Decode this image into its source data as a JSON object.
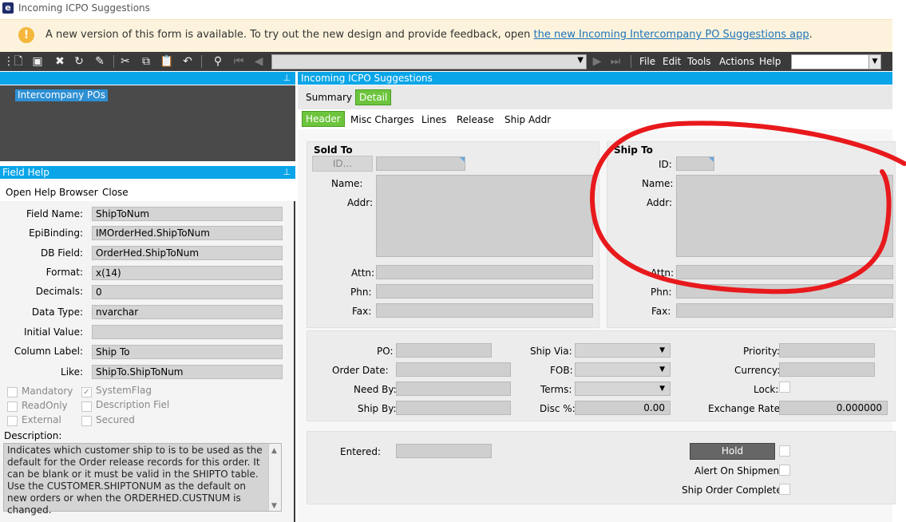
{
  "window": {
    "title": "Incoming ICPO Suggestions",
    "logo": "e"
  },
  "banner": {
    "icon": "warning-icon",
    "text": "A new version of this form is available. To try out the new design and provide feedback, open ",
    "link": "the new Incoming Intercompany PO Suggestions app",
    "suffix": "."
  },
  "menu": {
    "file": "File",
    "edit": "Edit",
    "tools": "Tools",
    "actions": "Actions",
    "help": "Help"
  },
  "tree": {
    "node": "Intercompany POs"
  },
  "field_help": {
    "title": "Field Help",
    "open_help": "Open Help Browser",
    "close": "Close",
    "rows": [
      {
        "label": "Field Name:",
        "value": "ShipToNum"
      },
      {
        "label": "EpiBinding:",
        "value": "IMOrderHed.ShipToNum"
      },
      {
        "label": "DB Field:",
        "value": "OrderHed.ShipToNum"
      },
      {
        "label": "Format:",
        "value": "x(14)"
      },
      {
        "label": "Decimals:",
        "value": "0"
      },
      {
        "label": "Data Type:",
        "value": "nvarchar"
      },
      {
        "label": "Initial Value:",
        "value": ""
      },
      {
        "label": "Column Label:",
        "value": "Ship To"
      },
      {
        "label": "Like:",
        "value": "ShipTo.ShipToNum"
      }
    ],
    "flags": {
      "mandatory": "Mandatory",
      "systemflag": "SystemFlag",
      "readonly": "ReadOnly",
      "descfield": "Description Fiel",
      "external": "External",
      "secured": "Secured"
    },
    "description_label": "Description:",
    "description": "Indicates which customer ship to is to be used as the default for the Order release records for this order. It  can be blank or it must be valid in the SHIPTO table. Use the CUSTOMER.SHIPTONUM as the default on new orders or when the ORDERHED.CUSTNUM is changed."
  },
  "form": {
    "title": "Incoming ICPO Suggestions",
    "tabs": {
      "summary": "Summary",
      "detail": "Detail"
    },
    "subtabs": {
      "header": "Header",
      "misc": "Misc Charges",
      "lines": "Lines",
      "release": "Release",
      "shipaddr": "Ship Addr"
    },
    "sold_to": {
      "title": "Sold To",
      "id_btn": "ID...",
      "name": "Name:",
      "addr": "Addr:",
      "attn": "Attn:",
      "phn": "Phn:",
      "fax": "Fax:"
    },
    "ship_to": {
      "title": "Ship To",
      "id": "ID:",
      "name": "Name:",
      "addr": "Addr:",
      "attn": "Attn:",
      "phn": "Phn:",
      "fax": "Fax:"
    },
    "order": {
      "po": "PO:",
      "order_date": "Order Date:",
      "need_by": "Need By:",
      "ship_by": "Ship By:",
      "ship_via": "Ship Via:",
      "fob": "FOB:",
      "terms": "Terms:",
      "disc": "Disc %:",
      "disc_value": "0.00",
      "priority": "Priority:",
      "currency": "Currency:",
      "lock": "Lock:",
      "exchange_rate": "Exchange Rate:",
      "exchange_value": "0.000000"
    },
    "bottom": {
      "entered": "Entered:",
      "hold": "Hold",
      "alert": "Alert On Shipment:",
      "ship_complete": "Ship Order Complete:"
    }
  },
  "colors": {
    "accent": "#0aa5e8",
    "active_tab": "#6dc43d",
    "annotation": "#e8191c"
  }
}
